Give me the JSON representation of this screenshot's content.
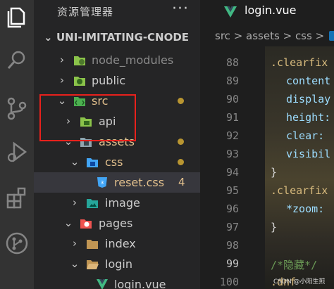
{
  "sidebar": {
    "title": "资源管理器",
    "more": "···",
    "root": "UNI-IMITATING-CNODE",
    "items": [
      {
        "label": "node_modules",
        "color": "#8b8b8b",
        "chevron": "›",
        "badge": ""
      },
      {
        "label": "public",
        "color": "#cccccc",
        "chevron": "›",
        "badge": ""
      },
      {
        "label": "src",
        "color": "#e2c08d",
        "chevron": "⌄",
        "badge": ""
      },
      {
        "label": "api",
        "color": "#cccccc",
        "chevron": "›",
        "badge": ""
      },
      {
        "label": "assets",
        "color": "#e2c08d",
        "chevron": "⌄",
        "badge": ""
      },
      {
        "label": "css",
        "color": "#e2c08d",
        "chevron": "⌄",
        "badge": ""
      },
      {
        "label": "reset.css",
        "color": "#e2c08d",
        "chevron": "",
        "badge": "4"
      },
      {
        "label": "image",
        "color": "#cccccc",
        "chevron": "›",
        "badge": ""
      },
      {
        "label": "pages",
        "color": "#cccccc",
        "chevron": "⌄",
        "badge": ""
      },
      {
        "label": "index",
        "color": "#cccccc",
        "chevron": "›",
        "badge": ""
      },
      {
        "label": "login",
        "color": "#cccccc",
        "chevron": "⌄",
        "badge": ""
      },
      {
        "label": "login.vue",
        "color": "#cccccc",
        "chevron": "",
        "badge": ""
      }
    ]
  },
  "editor": {
    "tab_label": "login.vue",
    "breadcrumb": {
      "parts": [
        "src",
        "assets",
        "css"
      ],
      "sep": ">"
    },
    "line_numbers": [
      "88",
      "89",
      "90",
      "91",
      "92",
      "93",
      "94",
      "95",
      "96",
      "97",
      "98",
      "99",
      "100"
    ],
    "code": {
      "l88": ".clearfix",
      "l89": "content",
      "l90": "display",
      "l91": "height:",
      "l92": "clear:",
      "l93": "visibil",
      "l94": "}",
      "l95": ".clearfix",
      "l96": "*zoom:",
      "l97": "}",
      "l99": "/*隐藏*/",
      "l100": ".dnf"
    }
  },
  "watermark": "CSDN @小阳生煎",
  "colors": {
    "accent_red": "#e8211c",
    "modified": "#e2c08d",
    "vue_green": "#41b883",
    "css_blue": "#1572b6"
  }
}
